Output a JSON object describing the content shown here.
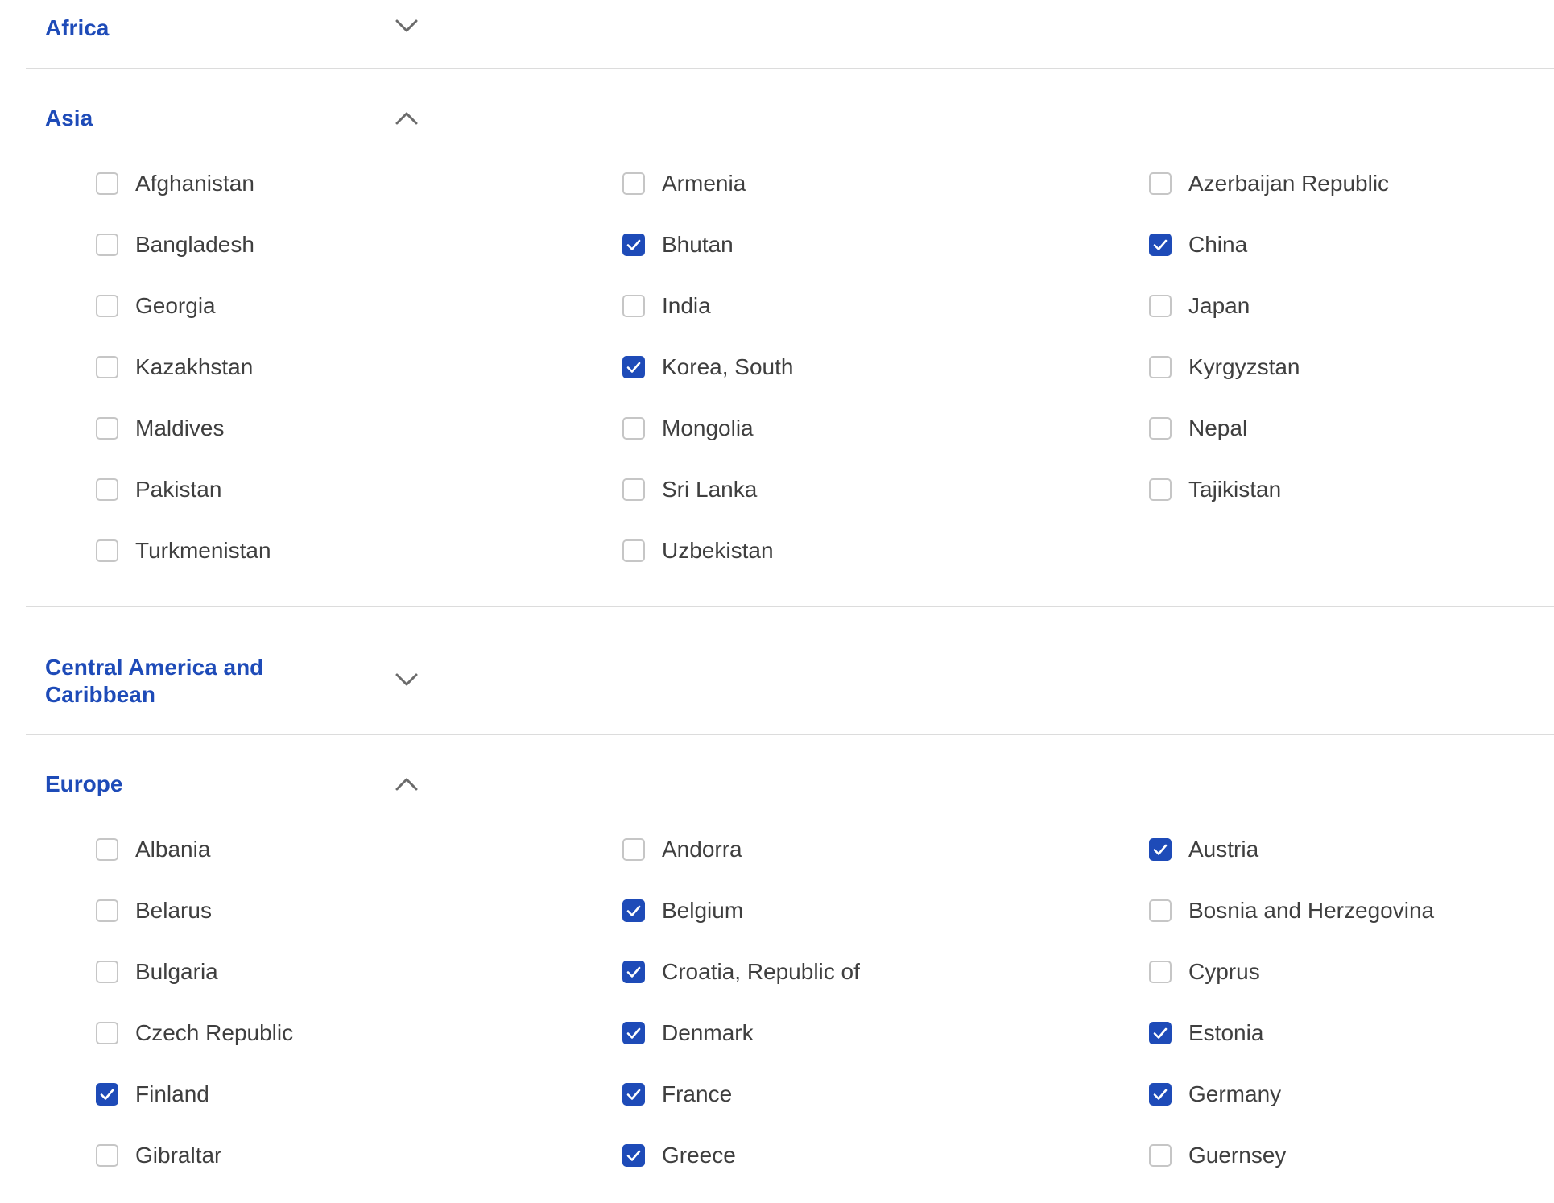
{
  "colors": {
    "accent": "#1e4bb8",
    "text": "#3f3f3f",
    "divider": "#dcdcdc",
    "checkbox_border": "#c6c6c6",
    "chevron": "#6b6b6b"
  },
  "regions": [
    {
      "name": "Africa",
      "expanded": false,
      "chevron_icon": "chevron-down-icon",
      "countries": []
    },
    {
      "name": "Asia",
      "expanded": true,
      "chevron_icon": "chevron-up-icon",
      "countries": [
        {
          "label": "Afghanistan",
          "checked": false
        },
        {
          "label": "Armenia",
          "checked": false
        },
        {
          "label": "Azerbaijan Republic",
          "checked": false
        },
        {
          "label": "Bangladesh",
          "checked": false
        },
        {
          "label": "Bhutan",
          "checked": true
        },
        {
          "label": "China",
          "checked": true
        },
        {
          "label": "Georgia",
          "checked": false
        },
        {
          "label": "India",
          "checked": false
        },
        {
          "label": "Japan",
          "checked": false
        },
        {
          "label": "Kazakhstan",
          "checked": false
        },
        {
          "label": "Korea, South",
          "checked": true
        },
        {
          "label": "Kyrgyzstan",
          "checked": false
        },
        {
          "label": "Maldives",
          "checked": false
        },
        {
          "label": "Mongolia",
          "checked": false
        },
        {
          "label": "Nepal",
          "checked": false
        },
        {
          "label": "Pakistan",
          "checked": false
        },
        {
          "label": "Sri Lanka",
          "checked": false
        },
        {
          "label": "Tajikistan",
          "checked": false
        },
        {
          "label": "Turkmenistan",
          "checked": false
        },
        {
          "label": "Uzbekistan",
          "checked": false
        }
      ]
    },
    {
      "name": "Central America and Caribbean",
      "expanded": false,
      "chevron_icon": "chevron-down-icon",
      "countries": []
    },
    {
      "name": "Europe",
      "expanded": true,
      "chevron_icon": "chevron-up-icon",
      "countries": [
        {
          "label": "Albania",
          "checked": false
        },
        {
          "label": "Andorra",
          "checked": false
        },
        {
          "label": "Austria",
          "checked": true
        },
        {
          "label": "Belarus",
          "checked": false
        },
        {
          "label": "Belgium",
          "checked": true
        },
        {
          "label": "Bosnia and Herzegovina",
          "checked": false
        },
        {
          "label": "Bulgaria",
          "checked": false
        },
        {
          "label": "Croatia, Republic of",
          "checked": true
        },
        {
          "label": "Cyprus",
          "checked": false
        },
        {
          "label": "Czech Republic",
          "checked": false
        },
        {
          "label": "Denmark",
          "checked": true
        },
        {
          "label": "Estonia",
          "checked": true
        },
        {
          "label": "Finland",
          "checked": true
        },
        {
          "label": "France",
          "checked": true
        },
        {
          "label": "Germany",
          "checked": true
        },
        {
          "label": "Gibraltar",
          "checked": false
        },
        {
          "label": "Greece",
          "checked": true
        },
        {
          "label": "Guernsey",
          "checked": false
        }
      ]
    }
  ]
}
